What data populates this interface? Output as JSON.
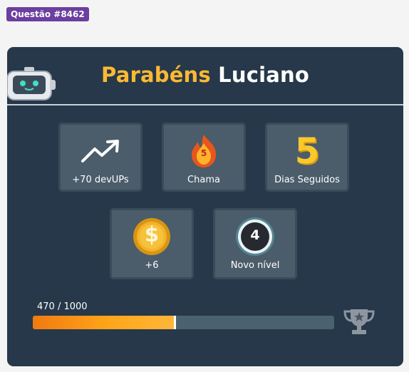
{
  "badge": {
    "text": "Questão #8462"
  },
  "header": {
    "greeting": "Parabéns",
    "name": "Luciano"
  },
  "tiles": {
    "devups": {
      "label": "+70 devUPs",
      "icon": "trending-up-icon"
    },
    "flame": {
      "label": "Chama",
      "value": "5",
      "icon": "flame-icon"
    },
    "days": {
      "label": "Dias Seguidos",
      "value": "5"
    },
    "coins": {
      "label": "+6",
      "symbol": "$",
      "icon": "coin-icon"
    },
    "level": {
      "label": "Novo nível",
      "value": "4"
    }
  },
  "progress": {
    "text": "470 / 1000",
    "current": 470,
    "max": 1000
  },
  "colors": {
    "card": "#26384a",
    "accent": "#fdb933",
    "badge": "#6a3fa0",
    "progress": "#ffa61a"
  }
}
